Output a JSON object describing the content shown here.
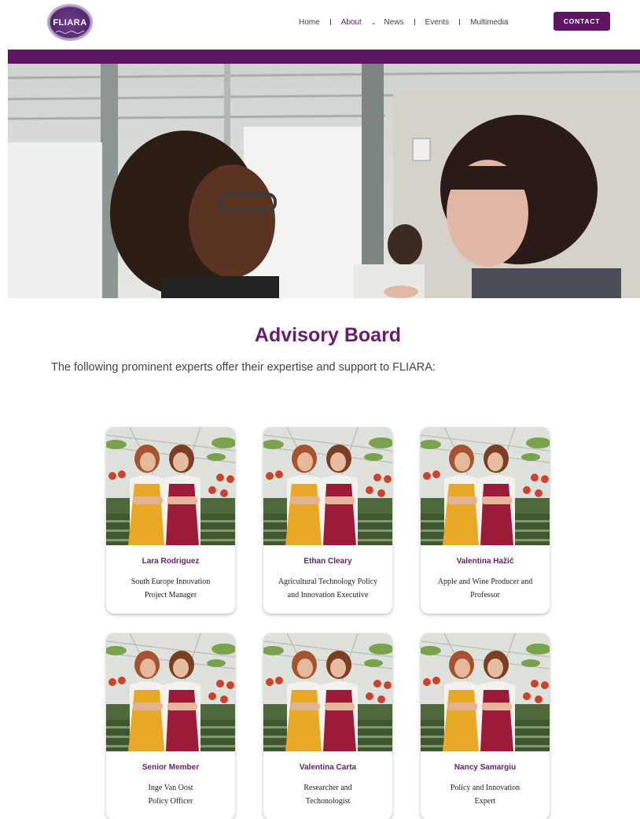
{
  "logo": {
    "text": "FLIARA"
  },
  "nav": {
    "items": [
      "Home",
      "About",
      "News",
      "Events",
      "Multimedia"
    ],
    "active": "About",
    "contact_label": "CONTACT"
  },
  "section": {
    "title": "Advisory Board",
    "intro": "The following prominent experts offer their expertise and support to FLIARA:"
  },
  "members": [
    {
      "name": "Lara Rodriguez",
      "role_line1": "South Europe Innovation",
      "role_line2": "Project Manager"
    },
    {
      "name": "Ethan Cleary",
      "role_line1": "Agricultural Technology Policy",
      "role_line2": "and Innovation Executive"
    },
    {
      "name": "Valentina Hažić",
      "role_line1": "Apple and Wine Producer and",
      "role_line2": "Professor"
    },
    {
      "name": "Senior Member",
      "role_line1": "Inge Van Oost",
      "role_line2": "Policy Officer"
    },
    {
      "name": "Valentina Carta",
      "role_line1": "Researcher and",
      "role_line2": "Techonologist"
    },
    {
      "name": "Nancy Samargiu",
      "role_line1": "Policy and Innovation",
      "role_line2": "Expert"
    }
  ],
  "colors": {
    "brand": "#5f1566",
    "title": "#6a1b6e",
    "apron_yellow": "#e9a825",
    "apron_red": "#9b1b38"
  }
}
